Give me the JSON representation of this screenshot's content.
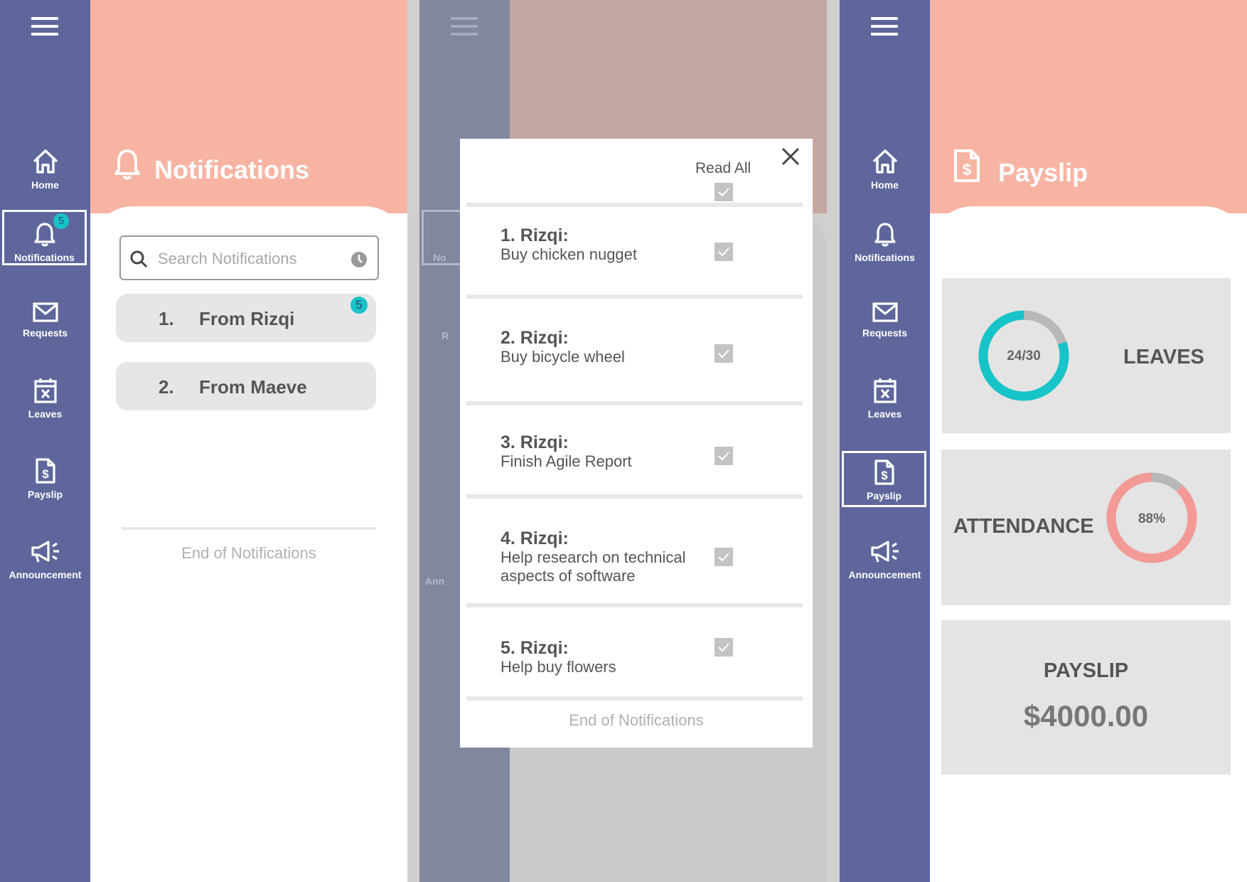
{
  "nav": {
    "home": "Home",
    "notifications": "Notifications",
    "requests": "Requests",
    "leaves": "Leaves",
    "payslip": "Payslip",
    "announcement": "Announcement",
    "notifications_badge": "5"
  },
  "screen1": {
    "title": "Notifications",
    "search_placeholder": "Search Notifications",
    "items": [
      {
        "num": "1.",
        "label": "From Rizqi",
        "badge": "5"
      },
      {
        "num": "2.",
        "label": "From Maeve"
      }
    ],
    "end_text": "End of Notifications"
  },
  "screen2": {
    "read_all": "Read All",
    "items": [
      {
        "title": "1. Rizqi:",
        "desc": "Buy chicken nugget"
      },
      {
        "title": "2. Rizqi:",
        "desc": "Buy bicycle wheel"
      },
      {
        "title": "3. Rizqi:",
        "desc": "Finish Agile Report"
      },
      {
        "title": "4. Rizqi:",
        "desc_line1": "Help research on technical",
        "desc_line2": "aspects of software"
      },
      {
        "title": "5. Rizqi:",
        "desc": "Help buy flowers"
      }
    ],
    "end_text": "End of Notifications",
    "background_partial": {
      "no": "No",
      "r": "R",
      "ann": "Ann"
    }
  },
  "screen3": {
    "title": "Payslip",
    "leaves": {
      "label": "LEAVES",
      "value_text": "24/30",
      "used": 24,
      "total": 30
    },
    "attendance": {
      "label": "ATTENDANCE",
      "value_text": "88%",
      "percent": 88
    },
    "payslip": {
      "label": "PAYSLIP",
      "amount": "$4000.00"
    }
  },
  "colors": {
    "sidebar": "#5e669c",
    "banner": "#f8b4a3",
    "accent_teal": "#17c4c8",
    "accent_salmon": "#f39a96",
    "ring_track": "#b8b8b8"
  }
}
